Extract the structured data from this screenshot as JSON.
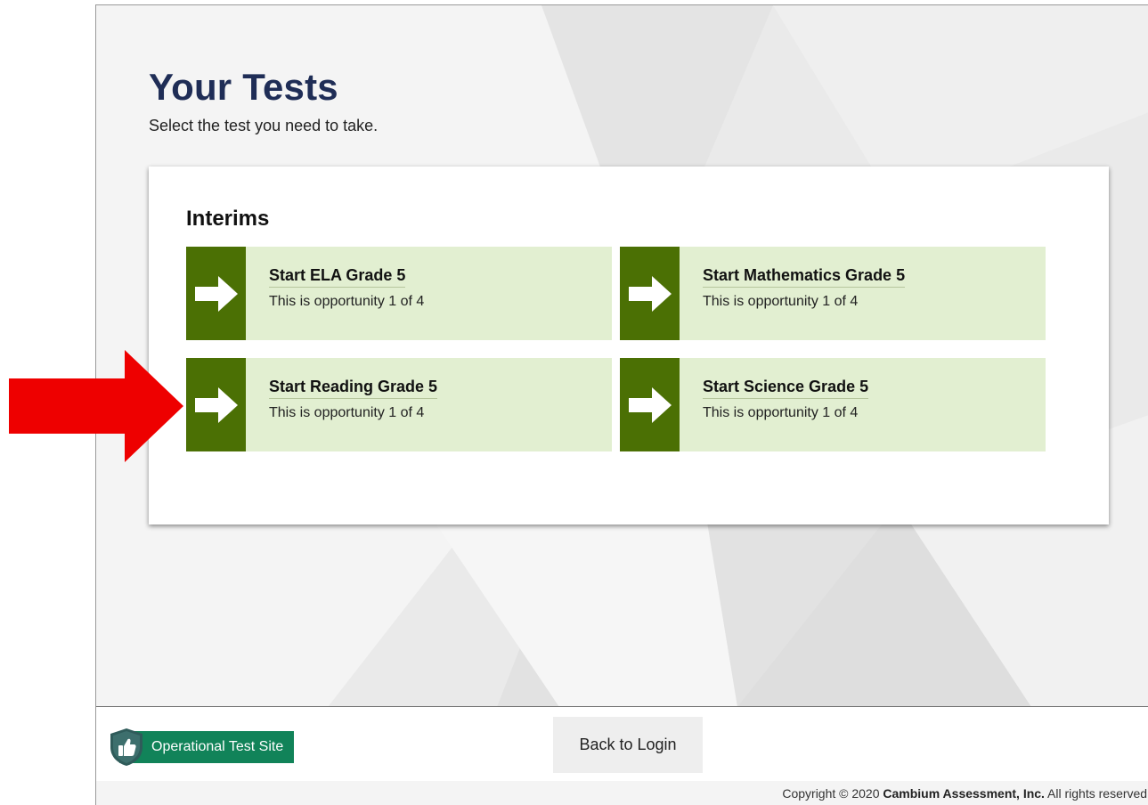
{
  "page": {
    "title": "Your Tests",
    "subtitle": "Select the test you need to take."
  },
  "section": {
    "heading": "Interims",
    "tests": [
      {
        "title": "Start ELA Grade 5",
        "opportunity": "This is opportunity 1 of 4",
        "icon": "arrow-right-icon"
      },
      {
        "title": "Start Mathematics Grade 5",
        "opportunity": "This is opportunity 1 of 4",
        "icon": "arrow-right-icon"
      },
      {
        "title": "Start Reading Grade 5",
        "opportunity": "This is opportunity 1 of 4",
        "icon": "arrow-right-icon"
      },
      {
        "title": "Start Science Grade 5",
        "opportunity": "This is opportunity 1 of 4",
        "icon": "arrow-right-icon"
      }
    ]
  },
  "footer": {
    "site_label": "Operational Test Site",
    "site_icon": "thumbs-up-shield-icon",
    "back_button": "Back to Login",
    "copyright_prefix": "Copyright © 2020 ",
    "copyright_company": "Cambium Assessment, Inc.",
    "copyright_suffix": " All rights reserved."
  },
  "colors": {
    "title": "#1f2d56",
    "tile_background": "#e2efd1",
    "tile_arrow": "#4b7004",
    "site_badge": "#118359",
    "annotation_arrow": "#ee0000"
  }
}
